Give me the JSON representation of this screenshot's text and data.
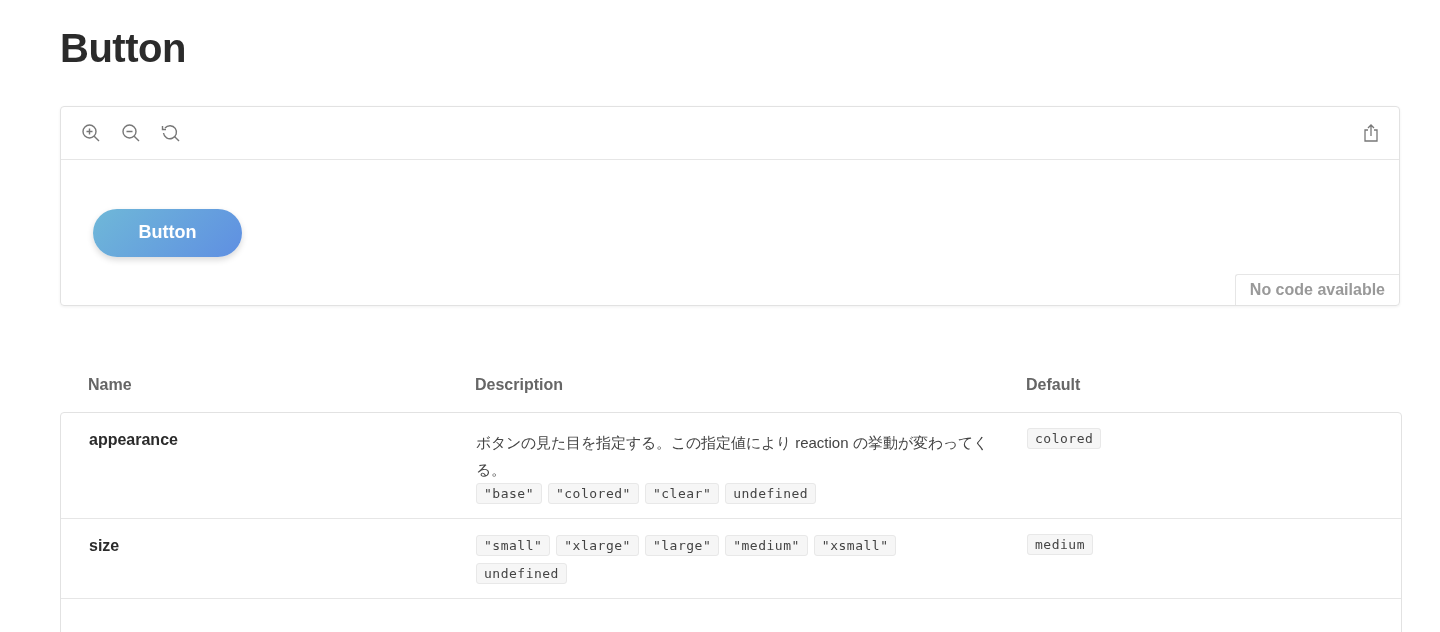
{
  "title": "Button",
  "preview": {
    "button_label": "Button",
    "code_note": "No code available"
  },
  "props_table": {
    "columns": [
      "Name",
      "Description",
      "Default"
    ],
    "rows": [
      {
        "name": "appearance",
        "description": "ボタンの見た目を指定する。この指定値により reaction の挙動が変わってくる。",
        "values": [
          "\"base\"",
          "\"colored\"",
          "\"clear\"",
          "undefined"
        ],
        "default": "colored"
      },
      {
        "name": "size",
        "values": [
          "\"small\"",
          "\"xlarge\"",
          "\"large\"",
          "\"medium\"",
          "\"xsmall\"",
          "undefined"
        ],
        "default": "medium"
      }
    ]
  }
}
